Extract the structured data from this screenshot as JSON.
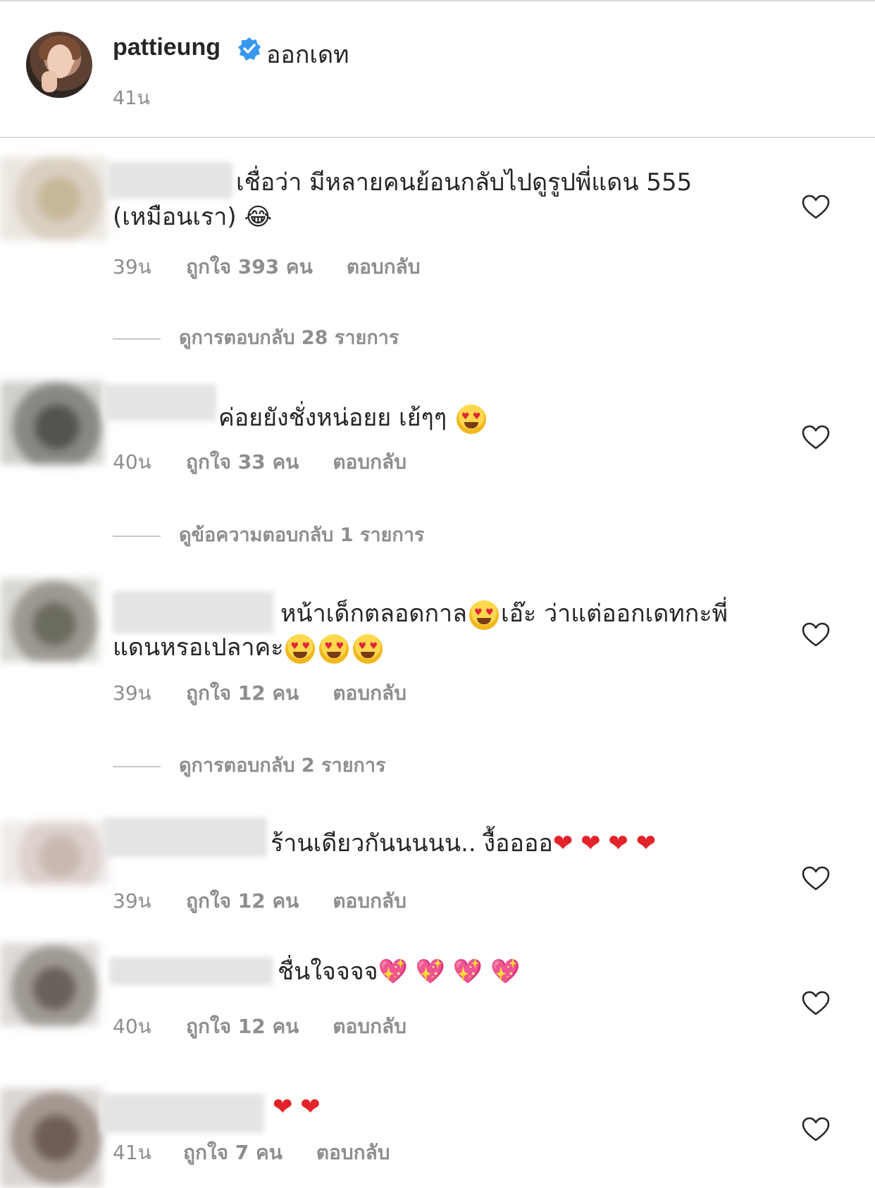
{
  "post": {
    "username": "pattieung",
    "caption": "ออกเดท",
    "time": "41น",
    "verified_icon": "verified-badge-icon"
  },
  "comments": [
    {
      "text_line1": "เชื่อว่า มีหลายคนย้อนกลับไปดูรูปพี่แดน 555",
      "text_line2": "(เหมือนเรา)",
      "emoji": "😂",
      "time": "39น",
      "likes": "ถูกใจ 393 คน",
      "reply": "ตอบกลับ",
      "view_replies": "ดูการตอบกลับ 28 รายการ"
    },
    {
      "text_line1": "ค่อยยังชั่งหน่อยย เย้ๆๆ",
      "time": "40น",
      "likes": "ถูกใจ 33 คน",
      "reply": "ตอบกลับ",
      "view_replies": "ดูข้อความตอบกลับ 1 รายการ"
    },
    {
      "text_line1a": "หน้าเด็กตลอดกาล",
      "text_line1b": "เอ๊ะ ว่าแต่ออกเดทกะพี่",
      "text_line2": "แดนหรอเปลาคะ",
      "time": "39น",
      "likes": "ถูกใจ 12 คน",
      "reply": "ตอบกลับ",
      "view_replies": "ดูการตอบกลับ 2 รายการ"
    },
    {
      "text_line1": "ร้านเดียวกันนนนน.. งื้ออออ",
      "time": "39น",
      "likes": "ถูกใจ 12 คน",
      "reply": "ตอบกลับ"
    },
    {
      "text_line1": "ชื่นใจจจจ",
      "time": "40น",
      "likes": "ถูกใจ 12 คน",
      "reply": "ตอบกลับ"
    },
    {
      "text_line1": "",
      "time": "41น",
      "likes": "ถูกใจ 7 คน",
      "reply": "ตอบกลับ"
    }
  ],
  "icons": {
    "like": "heart-outline-icon",
    "emoji_heart_eyes": "heart-eyes-emoji",
    "emoji_red_heart": "red-heart-emoji",
    "emoji_sparkling_heart": "sparkling-heart-emoji"
  },
  "colors": {
    "text": "#262626",
    "muted": "#8e8e8e",
    "divider": "#dbdbdb",
    "verified": "#3897f0",
    "red_heart": "#e3222a"
  }
}
